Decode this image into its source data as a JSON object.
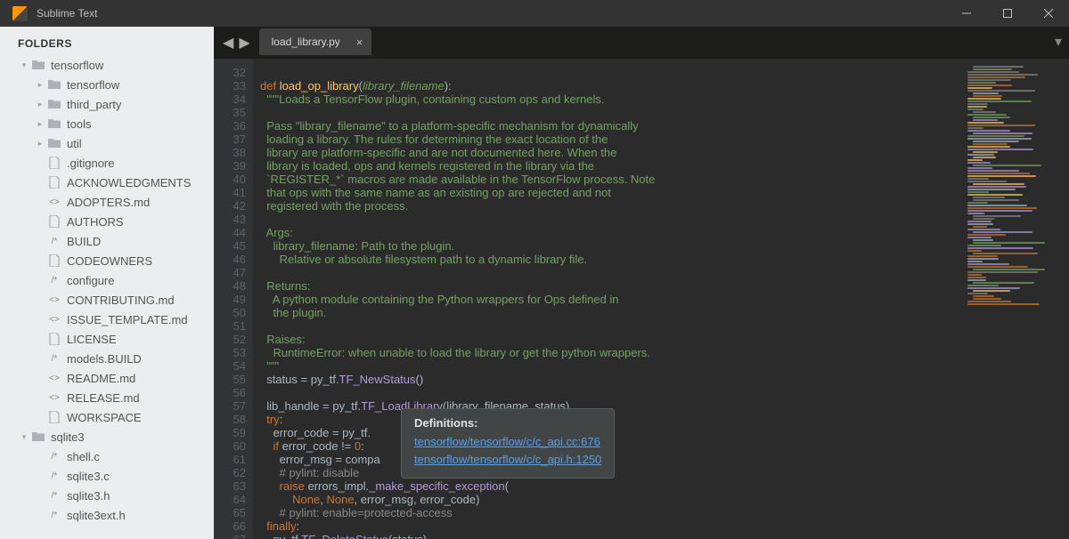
{
  "window": {
    "title": "Sublime Text"
  },
  "sidebar": {
    "header": "FOLDERS",
    "tree": [
      {
        "depth": 0,
        "arrow": "▾",
        "icon": "folder-open",
        "label": "tensorflow",
        "interact": true
      },
      {
        "depth": 1,
        "arrow": "▸",
        "icon": "folder",
        "label": "tensorflow",
        "interact": true
      },
      {
        "depth": 1,
        "arrow": "▸",
        "icon": "folder",
        "label": "third_party",
        "interact": true
      },
      {
        "depth": 1,
        "arrow": "▸",
        "icon": "folder",
        "label": "tools",
        "interact": true
      },
      {
        "depth": 1,
        "arrow": "▸",
        "icon": "folder",
        "label": "util",
        "interact": true
      },
      {
        "depth": 1,
        "arrow": "",
        "icon": "file",
        "label": ".gitignore",
        "interact": true
      },
      {
        "depth": 1,
        "arrow": "",
        "icon": "file",
        "label": "ACKNOWLEDGMENTS",
        "interact": true
      },
      {
        "depth": 1,
        "arrow": "",
        "icon": "md",
        "label": "ADOPTERS.md",
        "interact": true
      },
      {
        "depth": 1,
        "arrow": "",
        "icon": "file",
        "label": "AUTHORS",
        "interact": true
      },
      {
        "depth": 1,
        "arrow": "",
        "icon": "comment",
        "label": "BUILD",
        "interact": true
      },
      {
        "depth": 1,
        "arrow": "",
        "icon": "file",
        "label": "CODEOWNERS",
        "interact": true
      },
      {
        "depth": 1,
        "arrow": "",
        "icon": "comment",
        "label": "configure",
        "interact": true
      },
      {
        "depth": 1,
        "arrow": "",
        "icon": "md",
        "label": "CONTRIBUTING.md",
        "interact": true
      },
      {
        "depth": 1,
        "arrow": "",
        "icon": "md",
        "label": "ISSUE_TEMPLATE.md",
        "interact": true
      },
      {
        "depth": 1,
        "arrow": "",
        "icon": "file",
        "label": "LICENSE",
        "interact": true
      },
      {
        "depth": 1,
        "arrow": "",
        "icon": "comment",
        "label": "models.BUILD",
        "interact": true
      },
      {
        "depth": 1,
        "arrow": "",
        "icon": "md",
        "label": "README.md",
        "interact": true
      },
      {
        "depth": 1,
        "arrow": "",
        "icon": "md",
        "label": "RELEASE.md",
        "interact": true
      },
      {
        "depth": 1,
        "arrow": "",
        "icon": "file",
        "label": "WORKSPACE",
        "interact": true
      },
      {
        "depth": 0,
        "arrow": "▾",
        "icon": "folder-open",
        "label": "sqlite3",
        "interact": true
      },
      {
        "depth": 1,
        "arrow": "",
        "icon": "comment",
        "label": "shell.c",
        "interact": true
      },
      {
        "depth": 1,
        "arrow": "",
        "icon": "comment",
        "label": "sqlite3.c",
        "interact": true
      },
      {
        "depth": 1,
        "arrow": "",
        "icon": "comment",
        "label": "sqlite3.h",
        "interact": true
      },
      {
        "depth": 1,
        "arrow": "",
        "icon": "comment",
        "label": "sqlite3ext.h",
        "interact": true
      }
    ]
  },
  "tab": {
    "label": "load_library.py"
  },
  "code": {
    "first_line": 32,
    "lines": [
      [
        {
          "t": "",
          "c": ""
        }
      ],
      [
        {
          "t": "def ",
          "c": "kw"
        },
        {
          "t": "load_op_library",
          "c": "fn"
        },
        {
          "t": "(",
          "c": "punc"
        },
        {
          "t": "library_filename",
          "c": "param"
        },
        {
          "t": "):",
          "c": "punc"
        }
      ],
      [
        {
          "t": "  \"\"\"Loads a TensorFlow plugin, containing custom ops and kernels.",
          "c": "str"
        }
      ],
      [
        {
          "t": "",
          "c": ""
        }
      ],
      [
        {
          "t": "  Pass \"library_filename\" to a platform-specific mechanism for dynamically",
          "c": "str"
        }
      ],
      [
        {
          "t": "  loading a library. The rules for determining the exact location of the",
          "c": "str"
        }
      ],
      [
        {
          "t": "  library are platform-specific and are not documented here. When the",
          "c": "str"
        }
      ],
      [
        {
          "t": "  library is loaded, ops and kernels registered in the library via the",
          "c": "str"
        }
      ],
      [
        {
          "t": "  `REGISTER_*` macros are made available in the TensorFlow process. Note",
          "c": "str"
        }
      ],
      [
        {
          "t": "  that ops with the same name as an existing op are rejected and not",
          "c": "str"
        }
      ],
      [
        {
          "t": "  registered with the process.",
          "c": "str"
        }
      ],
      [
        {
          "t": "",
          "c": ""
        }
      ],
      [
        {
          "t": "  Args:",
          "c": "str"
        }
      ],
      [
        {
          "t": "    library_filename: Path to the plugin.",
          "c": "str"
        }
      ],
      [
        {
          "t": "      Relative or absolute filesystem path to a dynamic library file.",
          "c": "str"
        }
      ],
      [
        {
          "t": "",
          "c": ""
        }
      ],
      [
        {
          "t": "  Returns:",
          "c": "str"
        }
      ],
      [
        {
          "t": "    A python module containing the Python wrappers for Ops defined in",
          "c": "str"
        }
      ],
      [
        {
          "t": "    the plugin.",
          "c": "str"
        }
      ],
      [
        {
          "t": "",
          "c": ""
        }
      ],
      [
        {
          "t": "  Raises:",
          "c": "str"
        }
      ],
      [
        {
          "t": "    RuntimeError: when unable to load the library or get the python wrappers.",
          "c": "str"
        }
      ],
      [
        {
          "t": "  \"\"\"",
          "c": "str"
        }
      ],
      [
        {
          "t": "  status ",
          "c": "op"
        },
        {
          "t": "= ",
          "c": "op"
        },
        {
          "t": "py_tf.",
          "c": "op"
        },
        {
          "t": "TF_NewStatus",
          "c": "call"
        },
        {
          "t": "()",
          "c": "punc"
        }
      ],
      [
        {
          "t": "",
          "c": ""
        }
      ],
      [
        {
          "t": "  lib_handle ",
          "c": "op"
        },
        {
          "t": "= ",
          "c": "op"
        },
        {
          "t": "py_tf.",
          "c": "op"
        },
        {
          "t": "TF_LoadLibrary",
          "c": "call"
        },
        {
          "t": "(library_filename, status)",
          "c": "punc"
        }
      ],
      [
        {
          "t": "  ",
          "c": ""
        },
        {
          "t": "try",
          "c": "kw"
        },
        {
          "t": ":",
          "c": "punc"
        }
      ],
      [
        {
          "t": "    error_code ",
          "c": "op"
        },
        {
          "t": "= ",
          "c": "op"
        },
        {
          "t": "py_tf.",
          "c": "op"
        }
      ],
      [
        {
          "t": "    ",
          "c": ""
        },
        {
          "t": "if ",
          "c": "kw"
        },
        {
          "t": "error_code ",
          "c": "op"
        },
        {
          "t": "!= ",
          "c": "op"
        },
        {
          "t": "0",
          "c": "const"
        },
        {
          "t": ":",
          "c": "punc"
        }
      ],
      [
        {
          "t": "      error_msg ",
          "c": "op"
        },
        {
          "t": "= ",
          "c": "op"
        },
        {
          "t": "compa",
          "c": "op"
        }
      ],
      [
        {
          "t": "      ",
          "c": ""
        },
        {
          "t": "# pylint: disable",
          "c": "com"
        }
      ],
      [
        {
          "t": "      ",
          "c": ""
        },
        {
          "t": "raise ",
          "c": "kw"
        },
        {
          "t": "errors_impl.",
          "c": "op"
        },
        {
          "t": "_make_specific_exception",
          "c": "call"
        },
        {
          "t": "(",
          "c": "punc"
        }
      ],
      [
        {
          "t": "          ",
          "c": ""
        },
        {
          "t": "None",
          "c": "const"
        },
        {
          "t": ", ",
          "c": "punc"
        },
        {
          "t": "None",
          "c": "const"
        },
        {
          "t": ", error_msg, error_code)",
          "c": "punc"
        }
      ],
      [
        {
          "t": "      ",
          "c": ""
        },
        {
          "t": "# pylint: enable=protected-access",
          "c": "com"
        }
      ],
      [
        {
          "t": "  ",
          "c": ""
        },
        {
          "t": "finally",
          "c": "kw"
        },
        {
          "t": ":",
          "c": "punc"
        }
      ],
      [
        {
          "t": "    py_tf.",
          "c": "op"
        },
        {
          "t": "TF_DeleteStatus",
          "c": "call"
        },
        {
          "t": "(status)",
          "c": "punc"
        }
      ]
    ]
  },
  "popup": {
    "title": "Definitions:",
    "links": [
      "tensorflow/tensorflow/c/c_api.cc:676",
      "tensorflow/tensorflow/c/c_api.h:1250"
    ]
  }
}
